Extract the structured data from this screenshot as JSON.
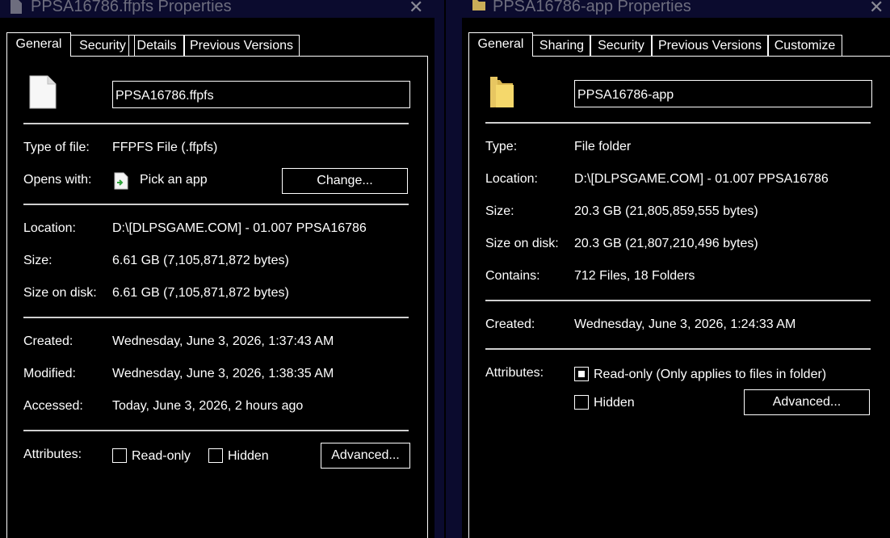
{
  "file_window": {
    "title": "PPSA16786.ffpfs Properties",
    "close_glyph": "✕",
    "tabs": [
      "General",
      "Security",
      "Details",
      "Previous Versions"
    ],
    "name_value": "PPSA16786.ffpfs",
    "type_label": "Type of file:",
    "type_value": "FFPFS File (.ffpfs)",
    "opens_label": "Opens with:",
    "opens_value": "Pick an app",
    "change_button": "Change...",
    "location_label": "Location:",
    "location_value": "D:\\[DLPSGAME.COM] - 01.007 PPSA16786",
    "size_label": "Size:",
    "size_value": "6.61 GB (7,105,871,872 bytes)",
    "size_on_disk_label": "Size on disk:",
    "size_on_disk_value": "6.61 GB (7,105,871,872 bytes)",
    "created_label": "Created:",
    "created_value": "Wednesday, June 3, 2026, 1:37:43 AM",
    "modified_label": "Modified:",
    "modified_value": "Wednesday, June 3, 2026, 1:38:35 AM",
    "accessed_label": "Accessed:",
    "accessed_value": "Today, June 3, 2026, 2 hours ago",
    "attributes_label": "Attributes:",
    "readonly_label": "Read-only",
    "readonly_checked": false,
    "hidden_label": "Hidden",
    "hidden_checked": false,
    "advanced_button": "Advanced..."
  },
  "folder_window": {
    "title": "PPSA16786-app Properties",
    "close_glyph": "✕",
    "tabs": [
      "General",
      "Sharing",
      "Security",
      "Previous Versions",
      "Customize"
    ],
    "name_value": "PPSA16786-app",
    "type_label": "Type:",
    "type_value": "File folder",
    "location_label": "Location:",
    "location_value": "D:\\[DLPSGAME.COM] - 01.007 PPSA16786",
    "size_label": "Size:",
    "size_value": "20.3 GB (21,805,859,555 bytes)",
    "size_on_disk_label": "Size on disk:",
    "size_on_disk_value": "20.3 GB (21,807,210,496 bytes)",
    "contains_label": "Contains:",
    "contains_value": "712 Files, 18 Folders",
    "created_label": "Created:",
    "created_value": "Wednesday, June 3, 2026, 1:24:33 AM",
    "attributes_label": "Attributes:",
    "readonly_label": "Read-only (Only applies to files in folder)",
    "readonly_checked": true,
    "hidden_label": "Hidden",
    "hidden_checked": false,
    "advanced_button": "Advanced..."
  },
  "icons": {
    "file": "document-icon",
    "folder": "folder-icon",
    "pick_app": "app-picker-icon"
  },
  "colors": {
    "background": "#000000",
    "titlebar": "#0b0b2e",
    "title_text": "#6d6d7e",
    "foreground": "#ffffff",
    "folder_yellow": "#f5d86b",
    "app_icon_green": "#2fa33b"
  }
}
